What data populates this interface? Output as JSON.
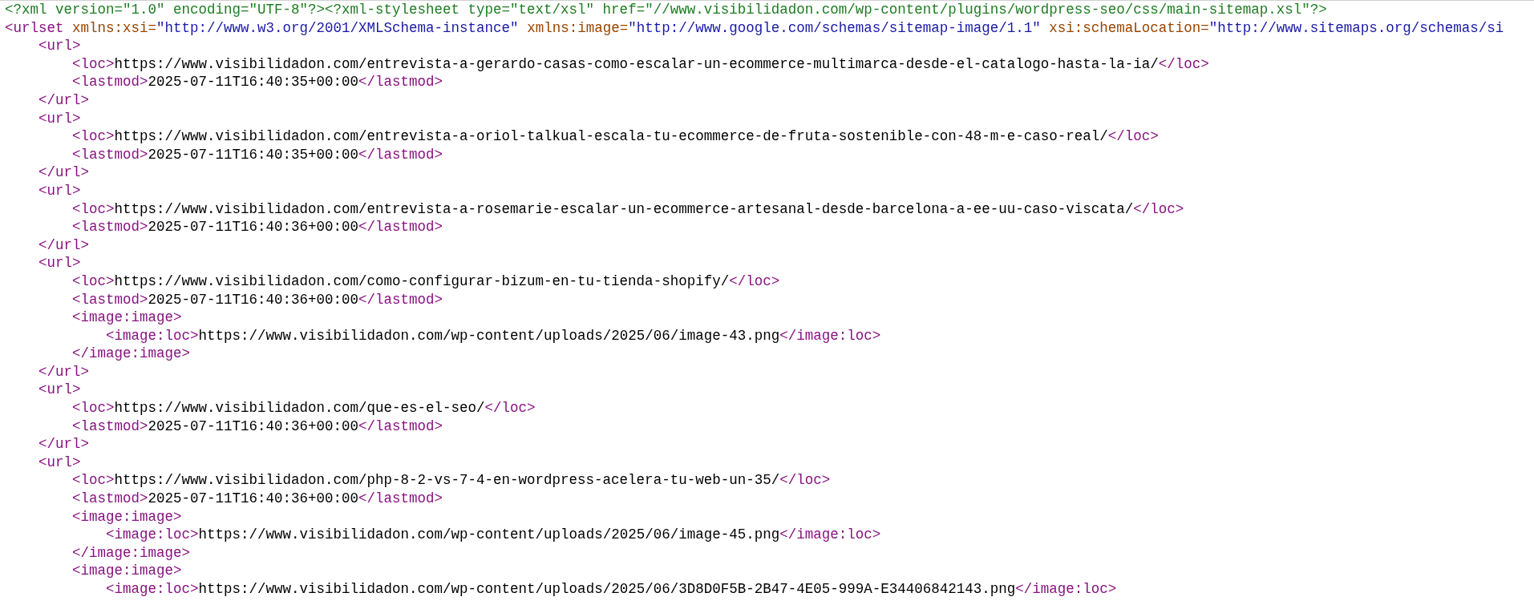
{
  "xml_declaration": "<?xml version=\"1.0\" encoding=\"UTF-8\"?><?xml-stylesheet type=\"text/xsl\" href=\"//www.visibilidadon.com/wp-content/plugins/wordpress-seo/css/main-sitemap.xsl\"?>",
  "root": {
    "open": "<urlset",
    "attributes": [
      {
        "name": "xmlns:xsi=",
        "value": "\"http://www.w3.org/2001/XMLSchema-instance\""
      },
      {
        "name": "xmlns:image=",
        "value": "\"http://www.google.com/schemas/sitemap-image/1.1\""
      },
      {
        "name": "xsi:schemaLocation=",
        "value": "\"http://www.sitemaps.org/schemas/si"
      }
    ],
    "children": [
      {
        "open": "<url>",
        "close": "</url>",
        "children": [
          {
            "open": "<loc>",
            "text": "https://www.visibilidadon.com/entrevista-a-gerardo-casas-como-escalar-un-ecommerce-multimarca-desde-el-catalogo-hasta-la-ia/",
            "close": "</loc>"
          },
          {
            "open": "<lastmod>",
            "text": "2025-07-11T16:40:35+00:00",
            "close": "</lastmod>"
          }
        ]
      },
      {
        "open": "<url>",
        "close": "</url>",
        "children": [
          {
            "open": "<loc>",
            "text": "https://www.visibilidadon.com/entrevista-a-oriol-talkual-escala-tu-ecommerce-de-fruta-sostenible-con-48-m-e-caso-real/",
            "close": "</loc>"
          },
          {
            "open": "<lastmod>",
            "text": "2025-07-11T16:40:35+00:00",
            "close": "</lastmod>"
          }
        ]
      },
      {
        "open": "<url>",
        "close": "</url>",
        "children": [
          {
            "open": "<loc>",
            "text": "https://www.visibilidadon.com/entrevista-a-rosemarie-escalar-un-ecommerce-artesanal-desde-barcelona-a-ee-uu-caso-viscata/",
            "close": "</loc>"
          },
          {
            "open": "<lastmod>",
            "text": "2025-07-11T16:40:36+00:00",
            "close": "</lastmod>"
          }
        ]
      },
      {
        "open": "<url>",
        "close": "</url>",
        "children": [
          {
            "open": "<loc>",
            "text": "https://www.visibilidadon.com/como-configurar-bizum-en-tu-tienda-shopify/",
            "close": "</loc>"
          },
          {
            "open": "<lastmod>",
            "text": "2025-07-11T16:40:36+00:00",
            "close": "</lastmod>"
          },
          {
            "open": "<image:image>",
            "close": "</image:image>",
            "children": [
              {
                "open": "<image:loc>",
                "text": "https://www.visibilidadon.com/wp-content/uploads/2025/06/image-43.png",
                "close": "</image:loc>"
              }
            ]
          }
        ]
      },
      {
        "open": "<url>",
        "close": "</url>",
        "children": [
          {
            "open": "<loc>",
            "text": "https://www.visibilidadon.com/que-es-el-seo/",
            "close": "</loc>"
          },
          {
            "open": "<lastmod>",
            "text": "2025-07-11T16:40:36+00:00",
            "close": "</lastmod>"
          }
        ]
      },
      {
        "open": "<url>",
        "children": [
          {
            "open": "<loc>",
            "text": "https://www.visibilidadon.com/php-8-2-vs-7-4-en-wordpress-acelera-tu-web-un-35/",
            "close": "</loc>"
          },
          {
            "open": "<lastmod>",
            "text": "2025-07-11T16:40:36+00:00",
            "close": "</lastmod>"
          },
          {
            "open": "<image:image>",
            "close": "</image:image>",
            "children": [
              {
                "open": "<image:loc>",
                "text": "https://www.visibilidadon.com/wp-content/uploads/2025/06/image-45.png",
                "close": "</image:loc>"
              }
            ]
          },
          {
            "open": "<image:image>",
            "children": [
              {
                "open": "<image:loc>",
                "text": "https://www.visibilidadon.com/wp-content/uploads/2025/06/3D8D0F5B-2B47-4E05-999A-E34406842143.png",
                "close": "</image:loc>"
              }
            ]
          }
        ]
      }
    ]
  }
}
